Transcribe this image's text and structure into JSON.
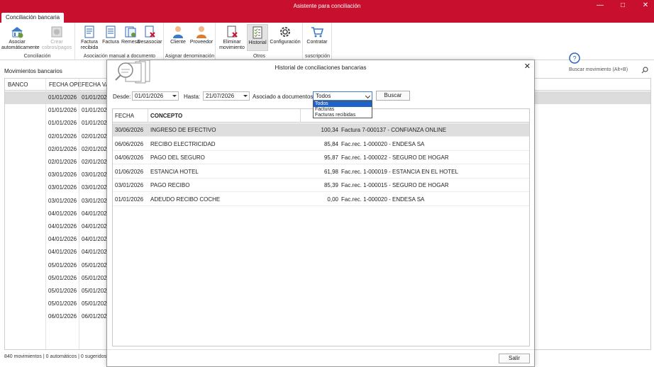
{
  "window": {
    "title": "Asistente para conciliación"
  },
  "ribbon": {
    "tab": "Conciliación bancaria",
    "groups": [
      {
        "label": "Conciliación"
      },
      {
        "label": "Asociación manual a documento"
      },
      {
        "label": "Asignar denominación"
      },
      {
        "label": "Otros"
      },
      {
        "label": "suscripción"
      }
    ],
    "buttons": {
      "asociar": "Asociar automáticamente",
      "crear": "Crear cobros/pagos",
      "factura_recibida": "Factura recibida",
      "factura": "Factura",
      "remesa": "Remesa",
      "desasociar": "Desasociar",
      "cliente": "Cliente",
      "proveedor": "Proveedor",
      "eliminar": "Eliminar movimiento",
      "historial": "Historial",
      "configuracion": "Configuración",
      "contratar": "Contratar"
    }
  },
  "main": {
    "title": "Movimientos bancarios",
    "search_placeholder": "Buscar movimiento (Alt+B)",
    "columns": [
      "BANCO",
      "FECHA OPE.",
      "FECHA VAL"
    ],
    "rows": [
      [
        "01/01/2026",
        "01/01/2026"
      ],
      [
        "01/01/2026",
        "01/01/2026"
      ],
      [
        "01/01/2026",
        "01/01/2026"
      ],
      [
        "02/01/2026",
        "02/01/2026"
      ],
      [
        "02/01/2026",
        "02/01/2026"
      ],
      [
        "02/01/2026",
        "02/01/2026"
      ],
      [
        "03/01/2026",
        "03/01/2026"
      ],
      [
        "03/01/2026",
        "03/01/2026"
      ],
      [
        "03/01/2026",
        "03/01/2026"
      ],
      [
        "04/01/2026",
        "04/01/2026"
      ],
      [
        "04/01/2026",
        "04/01/2026"
      ],
      [
        "04/01/2026",
        "04/01/2026"
      ],
      [
        "04/01/2026",
        "04/01/2026"
      ],
      [
        "05/01/2026",
        "05/01/2026"
      ],
      [
        "05/01/2026",
        "05/01/2026"
      ],
      [
        "05/01/2026",
        "05/01/2026"
      ],
      [
        "05/01/2026",
        "05/01/2026"
      ],
      [
        "06/01/2026",
        "06/01/2026"
      ]
    ],
    "status": "840 movimientos | 0 automáticos | 0 sugeridos"
  },
  "dialog": {
    "title": "Historial de conciliaciones bancarias",
    "desde_label": "Desde:",
    "desde_value": "01/01/2026",
    "hasta_label": "Hasta:",
    "hasta_value": "21/07/2026",
    "asociado_label": "Asociado  a documentos:",
    "asociado_value": "Todos",
    "asociado_options": [
      "Todos",
      "Facturas",
      "Facturas recibidas"
    ],
    "buscar": "Buscar",
    "columns": {
      "fecha": "FECHA",
      "concepto": "CONCEPTO"
    },
    "rows": [
      {
        "fecha": "30/06/2026",
        "concepto": "INGRESO DE EFECTIVO",
        "importe": "100,34",
        "documento": "Factura 7-000137 - CONFIANZA ONLINE"
      },
      {
        "fecha": "06/06/2026",
        "concepto": "RECIBO ELECTRICIDAD",
        "importe": "85,84",
        "documento": "Fac.rec. 1-000020 - ENDESA SA"
      },
      {
        "fecha": "04/06/2026",
        "concepto": "PAGO DEL SEGURO",
        "importe": "95,87",
        "documento": "Fac.rec. 1-000022 - SEGURO DE HOGAR"
      },
      {
        "fecha": "01/06/2026",
        "concepto": "ESTANCIA HOTEL",
        "importe": "61,98",
        "documento": "Fac.rec. 1-000019 - ESTANCIA EN EL HOTEL"
      },
      {
        "fecha": "03/01/2026",
        "concepto": "PAGO RECIBO",
        "importe": "85,39",
        "documento": "Fac.rec. 1-000015 - SEGURO DE HOGAR"
      },
      {
        "fecha": "01/01/2026",
        "concepto": "ADEUDO RECIBO COCHE",
        "importe": "0,00",
        "documento": "Fac.rec. 1-000020 - ENDESA SA"
      }
    ],
    "salir": "Salir"
  },
  "colors": {
    "brand": "#c8102e",
    "selection": "#dcdcdc",
    "dropdown_highlight": "#1e63c8"
  }
}
